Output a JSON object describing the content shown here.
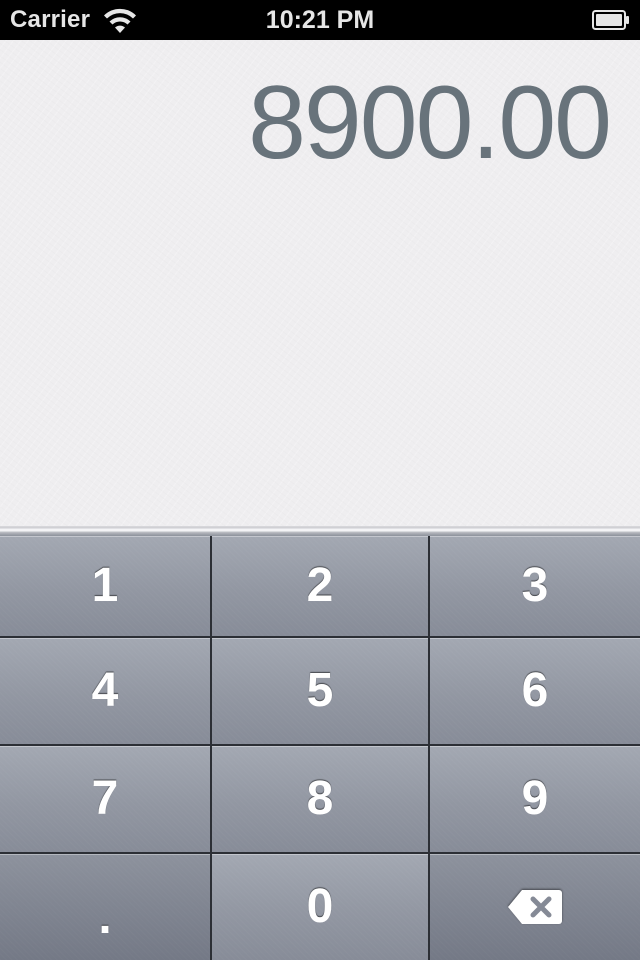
{
  "status_bar": {
    "carrier": "Carrier",
    "time": "10:21 PM",
    "wifi_icon": "wifi-icon",
    "battery_icon": "battery-icon",
    "battery_level": 1.0
  },
  "display": {
    "amount": "8900.00",
    "amount_color": "#68737b",
    "background_color": "#efeef0"
  },
  "keypad": {
    "key_color": "#9297a2",
    "rows": [
      [
        "1",
        "2",
        "3"
      ],
      [
        "4",
        "5",
        "6"
      ],
      [
        "7",
        "8",
        "9"
      ],
      [
        ".",
        "0",
        "delete"
      ]
    ],
    "delete_icon": "backspace-icon"
  }
}
